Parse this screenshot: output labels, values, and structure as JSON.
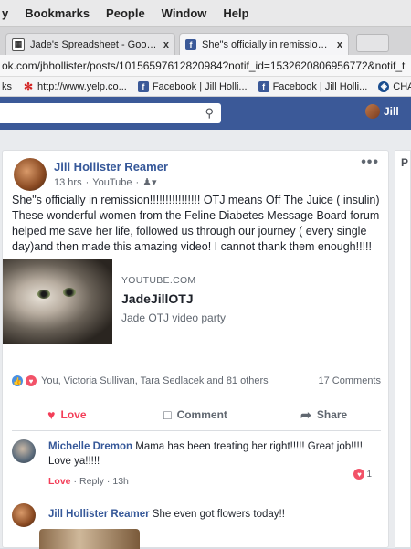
{
  "menubar": {
    "items": [
      "y",
      "Bookmarks",
      "People",
      "Window",
      "Help"
    ]
  },
  "tabs": [
    {
      "title": "Jade's Spreadsheet - Google S",
      "close": "x",
      "icon": "sheets-icon"
    },
    {
      "title": "She\"s officially in remission!!!!",
      "close": "x",
      "icon": "facebook-icon"
    }
  ],
  "url": "ok.com/jbhollister/posts/10156597612820984?notif_id=1532620806956772&notif_t",
  "bookmarks": [
    {
      "label": "ks",
      "icon": ""
    },
    {
      "label": "http://www.yelp.co...",
      "icon": "yelp-icon"
    },
    {
      "label": "Facebook | Jill Holli...",
      "icon": "facebook-icon"
    },
    {
      "label": "Facebook | Jill Holli...",
      "icon": "facebook-icon"
    },
    {
      "label": "CHASE",
      "icon": "chase-icon"
    }
  ],
  "fbbar": {
    "profile_name": "Jill"
  },
  "rightcol": {
    "label": "P"
  },
  "post": {
    "author": "Jill Hollister Reamer",
    "time": "13 hrs",
    "via": "YouTube",
    "text": "She\"s officially in remission!!!!!!!!!!!!!!!! OTJ means Off The Juice ( insulin) These wonderful women from the Feline Diabetes Message Board forum helped me save her life, followed us through our journey ( every single day)and then made this amazing video! I cannot thank them enough!!!!!",
    "link": {
      "source": "YOUTUBE.COM",
      "title": "JadeJillOTJ",
      "description": "Jade OTJ video party"
    },
    "reactions_text": "You, Victoria Sullivan, Tara Sedlacek and 81 others",
    "comments_count": "17 Comments",
    "actions": {
      "love": "Love",
      "comment": "Comment",
      "share": "Share"
    }
  },
  "comments": [
    {
      "name": "Michelle Dremon",
      "text": "Mama has been treating her right!!!!! Great job!!!! Love ya!!!!!",
      "love": "Love",
      "reply": "Reply",
      "time": "13h",
      "reaction_count": "1"
    },
    {
      "name": "Jill Hollister Reamer",
      "text": "She even got flowers today!!"
    }
  ],
  "colors": {
    "facebook_blue": "#3b5998",
    "link": "#365899",
    "love": "#f33e58"
  }
}
